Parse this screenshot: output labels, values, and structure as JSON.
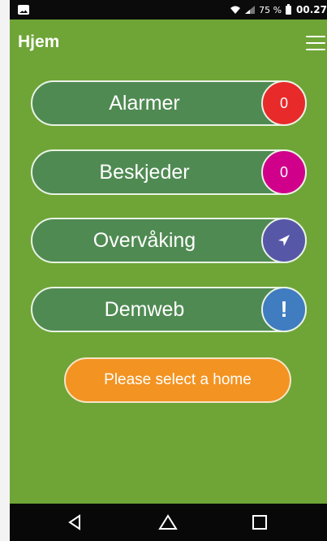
{
  "status_bar": {
    "battery_percent": "75 %",
    "time": "00.27",
    "icons": [
      "notification-icon",
      "wifi-icon",
      "signal-icon",
      "battery-icon"
    ]
  },
  "app_bar": {
    "title": "Hjem",
    "menu_icon": "hamburger-menu-icon"
  },
  "menu_items": [
    {
      "label": "Alarmer",
      "badge": "0",
      "badge_color": "#e82a2a"
    },
    {
      "label": "Beskjeder",
      "badge": "0",
      "badge_color": "#d1008a"
    },
    {
      "label": "Overvåking",
      "badge_icon": "send-arrow-icon",
      "badge_color": "#5757a8"
    },
    {
      "label": "Demweb",
      "badge": "!",
      "badge_color": "#3f7cc0"
    }
  ],
  "select_home": {
    "label": "Please select a home"
  },
  "nav_bar": {
    "icons": [
      "back-icon",
      "home-icon",
      "recents-icon"
    ]
  },
  "colors": {
    "background": "#6ea536",
    "pill": "#4f8a52",
    "select_button": "#f39321"
  }
}
